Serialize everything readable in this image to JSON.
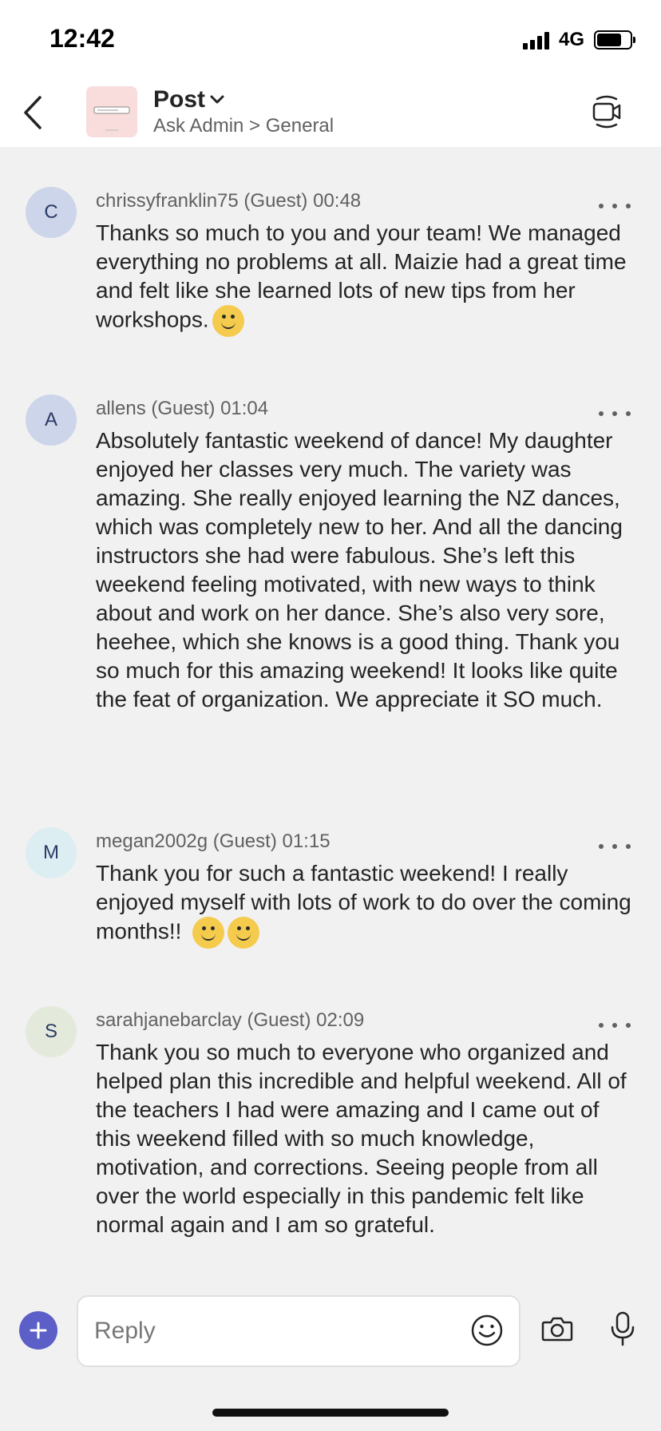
{
  "status_bar": {
    "time": "12:42",
    "network": "4G"
  },
  "header": {
    "title": "Post",
    "subtitle": "Ask Admin > General"
  },
  "messages": [
    {
      "initial": "C",
      "author": "chrissyfranklin75 (Guest)",
      "time": "00:48",
      "avatar_color": "#cdd5ea",
      "text": "Thanks so much to you and your team! We managed everything no problems at all. Maizie had a great time and felt like she learned lots of new tips from her workshops."
    },
    {
      "initial": "A",
      "author": "allens (Guest)",
      "time": "01:04",
      "avatar_color": "#cdd5ea",
      "text": "Absolutely fantastic weekend of dance!  My daughter enjoyed her classes very much. The variety was amazing. She really enjoyed learning the NZ dances, which was completely new to her.  And all the dancing instructors she had were fabulous. She’s left this weekend feeling motivated, with new ways to think about and work on her dance. She’s also very sore, heehee, which she knows is a good thing. Thank you so much for this amazing weekend!  It looks like quite the feat of organization. We appreciate it SO much."
    },
    {
      "initial": "M",
      "author": "megan2002g (Guest)",
      "time": "01:15",
      "avatar_color": "#dceef2",
      "text": "Thank you for such a fantastic weekend!  I really enjoyed myself with lots of work to do over the coming months!!"
    },
    {
      "initial": "S",
      "author": "sarahjanebarclay (Guest)",
      "time": "02:09",
      "avatar_color": "#e3eadb",
      "text": "Thank you so much to everyone who organized and helped plan this incredible and helpful weekend. All of the teachers I had were amazing and I came out of this weekend filled with so much knowledge, motivation, and corrections. Seeing people from all over the world especially in this pandemic felt like normal again and I am so grateful."
    }
  ],
  "composer": {
    "placeholder": "Reply"
  },
  "colors": {
    "accent": "#5b5fc7",
    "emoji": "#f5cb4e",
    "background": "#f1f1f1"
  }
}
